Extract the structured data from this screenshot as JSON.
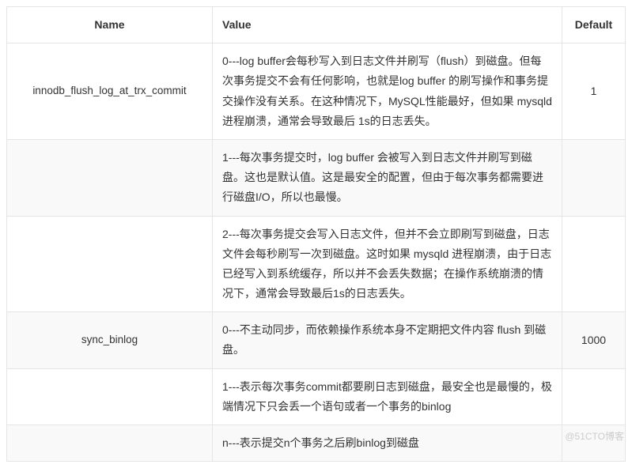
{
  "headers": {
    "name": "Name",
    "value": "Value",
    "default": "Default"
  },
  "rows": [
    {
      "alt": false,
      "name": "innodb_flush_log_at_trx_commit",
      "value": "0---log buffer会每秒写入到日志文件并刷写（flush）到磁盘。但每次事务提交不会有任何影响，也就是log buffer 的刷写操作和事务提交操作没有关系。在这种情况下，MySQL性能最好，但如果 mysqld 进程崩溃，通常会导致最后 1s的日志丢失。",
      "default": "1"
    },
    {
      "alt": true,
      "name": "",
      "value": "1---每次事务提交时，log buffer 会被写入到日志文件并刷写到磁盘。这也是默认值。这是最安全的配置，但由于每次事务都需要进行磁盘I/O，所以也最慢。",
      "default": ""
    },
    {
      "alt": false,
      "name": "",
      "value": "2---每次事务提交会写入日志文件，但并不会立即刷写到磁盘，日志文件会每秒刷写一次到磁盘。这时如果 mysqld 进程崩溃，由于日志已经写入到系统缓存，所以并不会丢失数据；在操作系统崩溃的情况下，通常会导致最后1s的日志丢失。",
      "default": ""
    },
    {
      "alt": true,
      "name": "sync_binlog",
      "value": "0---不主动同步，而依赖操作系统本身不定期把文件内容 flush 到磁盘。",
      "default": "1000"
    },
    {
      "alt": false,
      "name": "",
      "value": "1---表示每次事务commit都要刷日志到磁盘，最安全也是最慢的，极端情况下只会丢一个语句或者一个事务的binlog",
      "default": ""
    },
    {
      "alt": true,
      "name": "",
      "value": "n---表示提交n个事务之后刷binlog到磁盘",
      "default": ""
    }
  ],
  "watermark": "@51CTO博客"
}
